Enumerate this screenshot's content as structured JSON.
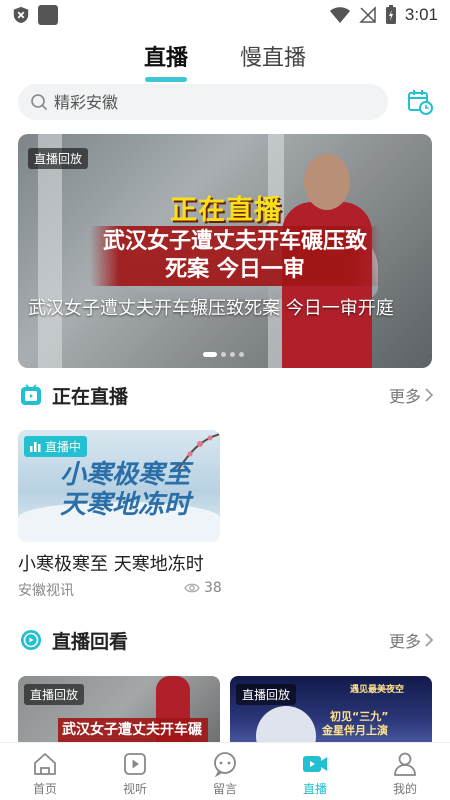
{
  "status_bar": {
    "time": "3:01"
  },
  "top_tabs": [
    {
      "label": "直播",
      "active": true
    },
    {
      "label": "慢直播",
      "active": false
    }
  ],
  "search": {
    "placeholder": "精彩安徽"
  },
  "banner": {
    "tag": "直播回放",
    "overlay_line1": "正在直播",
    "overlay_line2": "武汉女子遭丈夫开车碾压致死案 今日一审",
    "caption": "武汉女子遭丈夫开车辗压致死案 今日一审开庭",
    "slide_count": 4,
    "active_slide": 1
  },
  "live_section": {
    "title": "正在直播",
    "more": "更多",
    "card": {
      "badge": "直播中",
      "thumb_line1": "小寒极寒至",
      "thumb_line2": "天寒地冻时",
      "title": "小寒极寒至 天寒地冻时",
      "source": "安徽视讯",
      "views": "38"
    }
  },
  "replay_section": {
    "title": "直播回看",
    "more": "更多",
    "cards": [
      {
        "tag": "直播回放",
        "thumb_text": "武汉女子遭丈夫开车碾压"
      },
      {
        "tag": "直播回放",
        "thumb_text1": "遇见最美夜空",
        "thumb_text2": "初见“三九”",
        "thumb_text3": "金星伴月上演"
      }
    ]
  },
  "bottom_nav": [
    {
      "label": "首页",
      "icon": "home-icon",
      "active": false
    },
    {
      "label": "视听",
      "icon": "play-icon",
      "active": false
    },
    {
      "label": "留言",
      "icon": "message-icon",
      "active": false
    },
    {
      "label": "直播",
      "icon": "live-camera-icon",
      "active": true
    },
    {
      "label": "我的",
      "icon": "profile-icon",
      "active": false
    }
  ],
  "colors": {
    "accent": "#22c0d0",
    "live_red": "#b0202a",
    "highlight_yellow": "#f7e11a"
  }
}
